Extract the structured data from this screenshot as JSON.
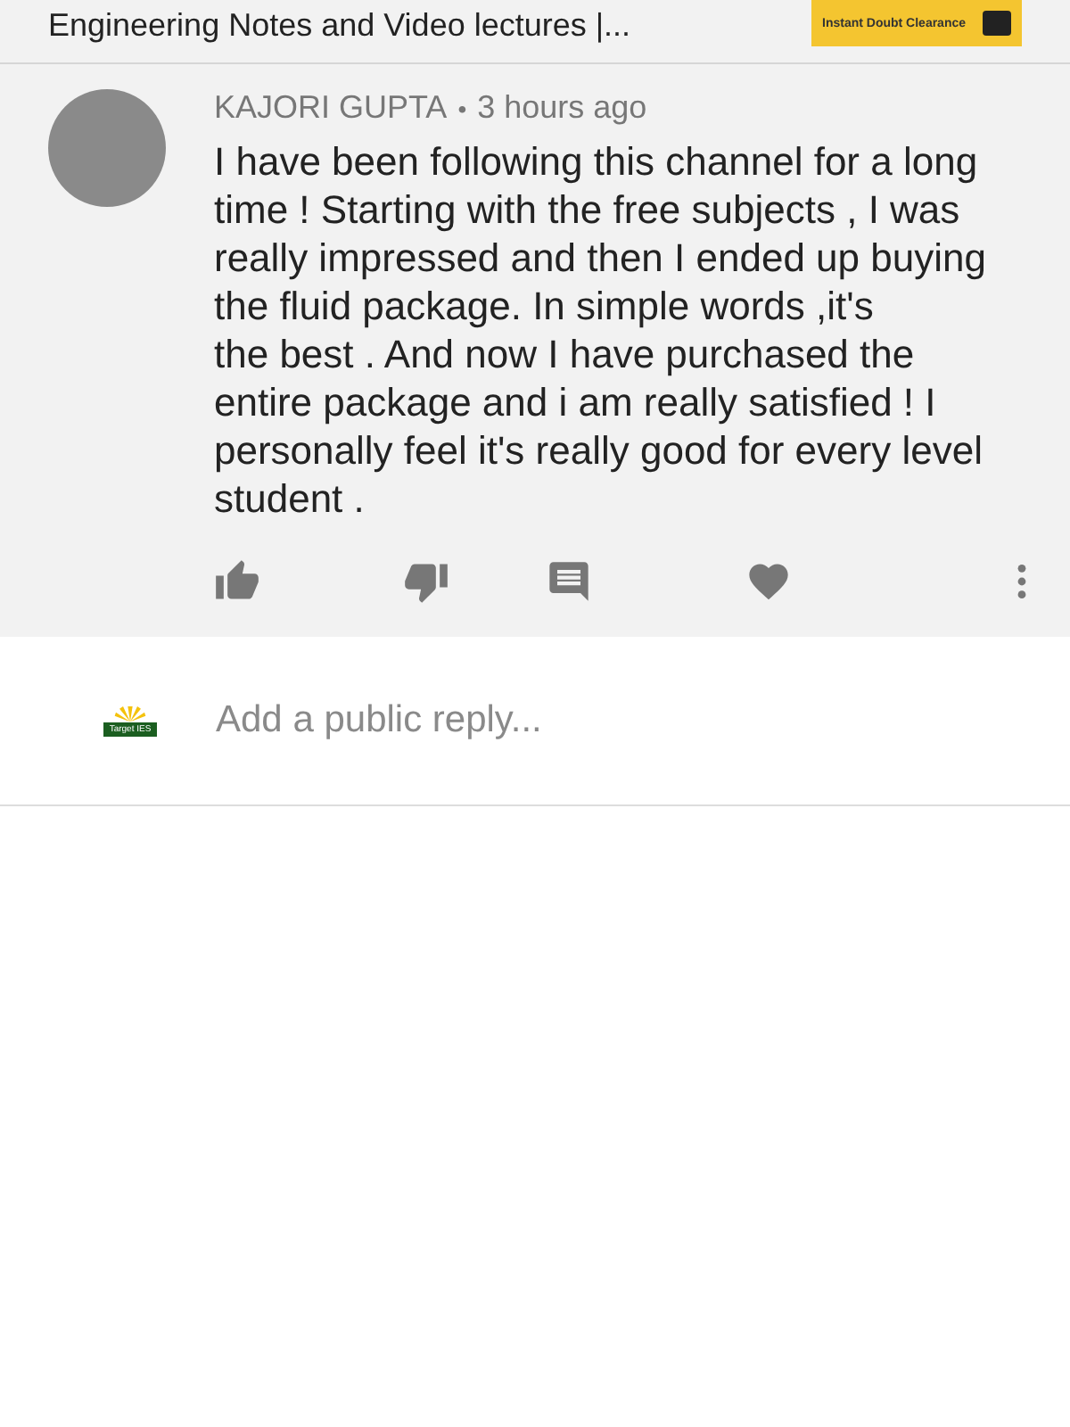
{
  "video": {
    "title": "Engineering Notes and Video lectures |...",
    "thumbnail_caption": "Instant Doubt Clearance"
  },
  "comment": {
    "author": "KAJORI GUPTA",
    "separator": "•",
    "time": "3 hours ago",
    "text": "I have been following this channel for a long time ! Starting with the free subjects , I was really impressed and then I ended up buying the fluid package. In simple words ,it's\nthe best . And now I have purchased the entire package and i am really satisfied ! I personally feel it's really good for every level student .",
    "liked": false,
    "hearted": false
  },
  "reply": {
    "logo_text": "Target IES",
    "placeholder": "Add a public reply..."
  }
}
